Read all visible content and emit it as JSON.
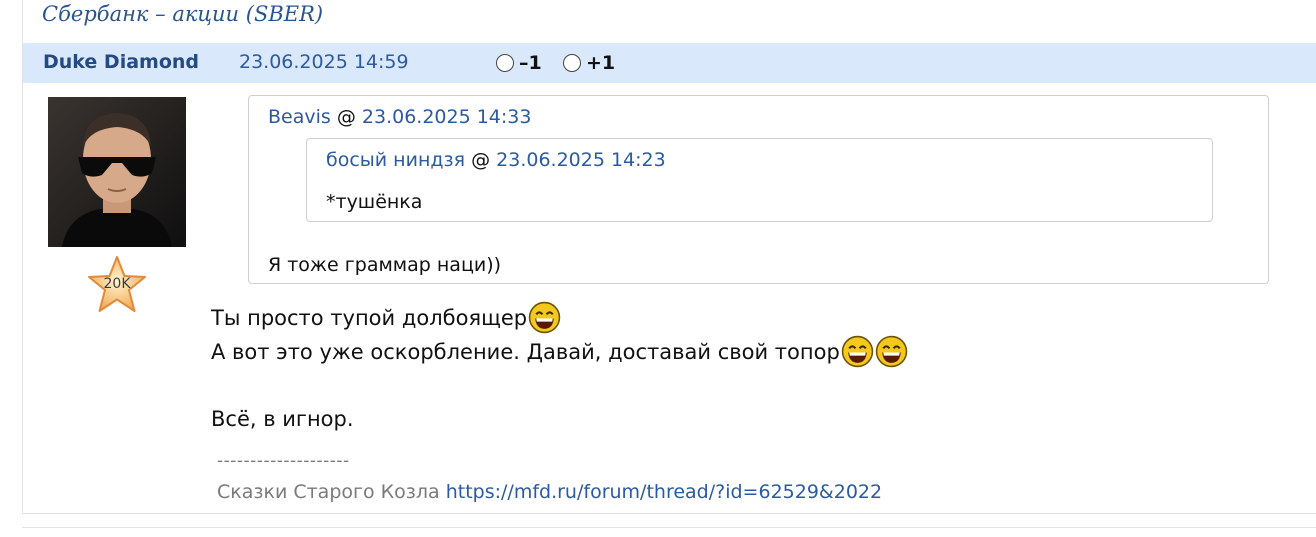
{
  "thread": {
    "title": "Сбербанк – акции (SBER)"
  },
  "post": {
    "author": "Duke Diamond",
    "date": "23.06.2025 14:59",
    "vote_minus_label": "–1",
    "vote_plus_label": "+1",
    "rating_badge": "20K"
  },
  "quote": {
    "author": "Beavis",
    "at": "@",
    "date": "23.06.2025 14:33",
    "text": "Я тоже граммар наци))",
    "nested": {
      "author": "босый ниндзя",
      "at": "@",
      "date": "23.06.2025 14:23",
      "text": "*тушёнка"
    }
  },
  "body": {
    "line1": "Ты просто тупой долбоящер",
    "line2": "А вот это уже оскорбление. Давай, доставай свой топор",
    "line3": "Всё, в игнор."
  },
  "signature": {
    "separator": "--------------------",
    "text": "Сказки Старого Козла",
    "link": "https://mfd.ru/forum/thread/?id=62529&2022"
  },
  "colors": {
    "header_bg": "#d9e8fb",
    "link": "#2c5aa0",
    "author": "#244a84"
  }
}
